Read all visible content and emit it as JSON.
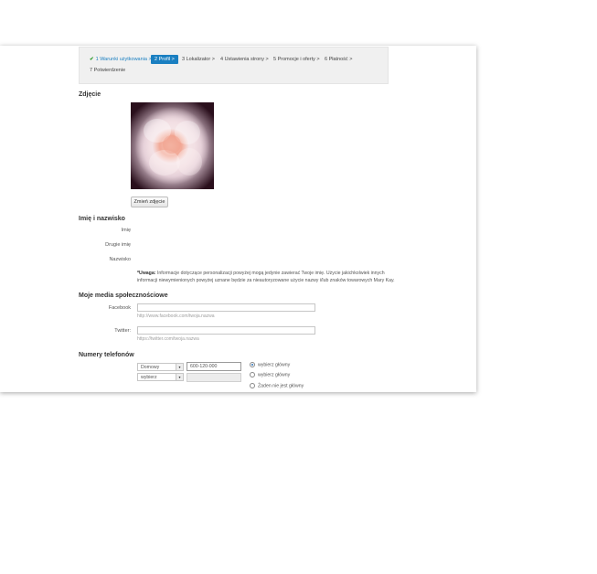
{
  "steps": [
    {
      "label": "1 Warunki użytkowania >",
      "state": "done"
    },
    {
      "label": "2 Profil >",
      "state": "active"
    },
    {
      "label": "3 Lokalizator >",
      "state": "pending"
    },
    {
      "label": "4 Ustawienia strony >",
      "state": "pending"
    },
    {
      "label": "5 Promocje i oferty >",
      "state": "pending"
    },
    {
      "label": "6 Płatność >",
      "state": "pending"
    },
    {
      "label": "7 Potwierdzenie",
      "state": "pending"
    }
  ],
  "photo": {
    "title": "Zdjęcie",
    "change_button": "Zmień zdjęcie"
  },
  "name": {
    "title": "Imię i nazwisko",
    "first_label": "Imię",
    "middle_label": "Drugie imię",
    "last_label": "Nazwisko",
    "note_bold": "*Uwaga:",
    "note_text": " Informacje dotyczące personalizacji powyżej mogą jedynie zawierać Twoje imię. Użycie jakichkolwiek innych informacji niewymienionych powyżej uznane będzie za nieautoryzowane użycie nazwy i/lub znaków towarowych Mary Kay."
  },
  "social": {
    "title": "Moje media społecznościowe",
    "facebook_label": "Facebook",
    "facebook_value": "",
    "facebook_hint": "http://www.facebook.com/twoja.nazwa",
    "twitter_label": "Twitter:",
    "twitter_value": "",
    "twitter_hint": "https://twitter.com/twoja.nazwa"
  },
  "phones": {
    "title": "Numery telefonów",
    "rows": [
      {
        "type": "Domowy",
        "number": "600-120-000"
      },
      {
        "type": "wybierz",
        "number": ""
      }
    ],
    "radio_options": [
      "wybierz główny",
      "wybierz główny",
      "Żaden nie jest główny"
    ],
    "selected_radio": 0
  },
  "colors": {
    "accent": "#1a7fc1",
    "check": "#2e9a2e"
  }
}
